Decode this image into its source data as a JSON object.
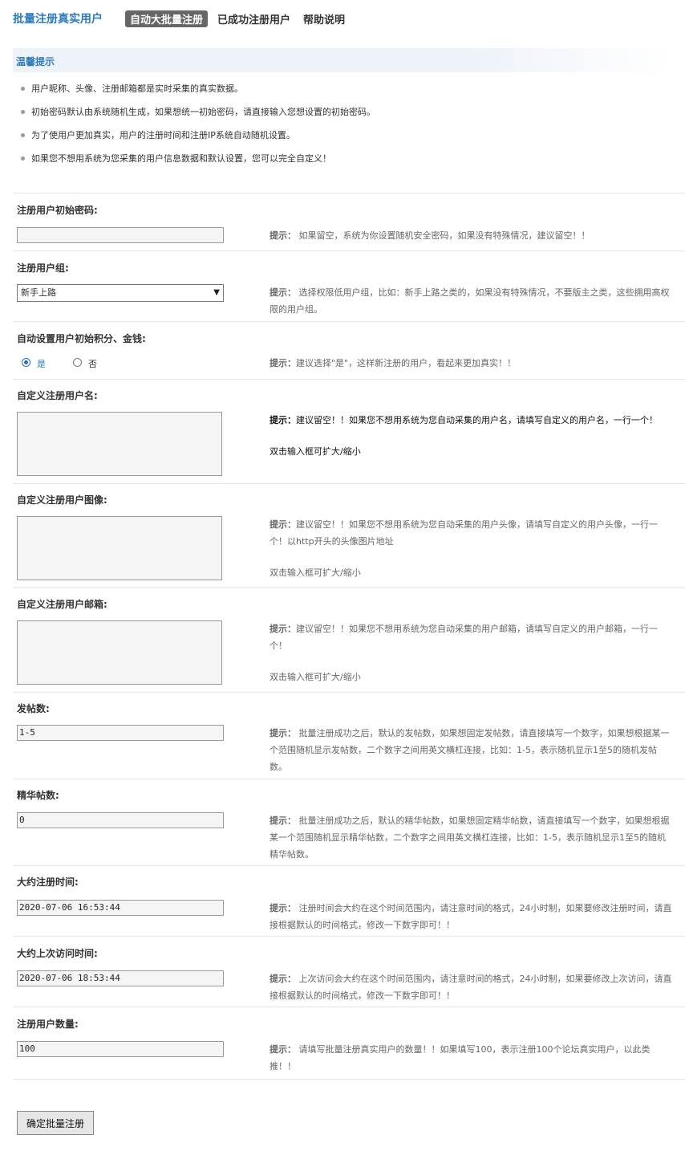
{
  "header": {
    "title": "批量注册真实用户",
    "tabs": [
      {
        "label": "自动大批量注册",
        "active": true
      },
      {
        "label": "已成功注册用户",
        "active": false
      },
      {
        "label": "帮助说明",
        "active": false
      }
    ]
  },
  "tips": {
    "title": "温馨提示",
    "items": [
      "用户昵称、头像、注册邮箱都是实时采集的真实数据。",
      "初始密码默认由系统随机生成，如果想统一初始密码，请直接输入您想设置的初始密码。",
      "为了使用户更加真实，用户的注册时间和注册IP系统自动随机设置。",
      "如果您不想用系统为您采集的用户信息数据和默认设置，您可以完全自定义！"
    ]
  },
  "hint_prefix": "提示：",
  "form": {
    "password": {
      "label": "注册用户初始密码:",
      "value": "",
      "hint": "如果留空，系统为你设置随机安全密码，如果没有特殊情况，建议留空！！"
    },
    "group": {
      "label": "注册用户组:",
      "selected": "新手上路",
      "hint": "选择权限低用户组，比如：新手上路之类的，如果没有特殊情况，不要版主之类，这些拥用高权限的用户组。"
    },
    "credits": {
      "label": "自动设置用户初始积分、金钱:",
      "option_yes": "是",
      "option_no": "否",
      "selected": "是",
      "hint": "建议选择\"是\"，这样新注册的用户，看起来更加真实！！"
    },
    "usernames": {
      "label": "自定义注册用户名:",
      "hint": "建议留空！！如果您不想用系统为您自动采集的用户名，请填写自定义的用户名，一行一个！",
      "sub": "双击输入框可扩大/缩小"
    },
    "avatars": {
      "label": "自定义注册用户图像:",
      "hint": "建议留空！！如果您不想用系统为您自动采集的用户头像，请填写自定义的用户头像，一行一个！以http开头的头像图片地址",
      "sub": "双击输入框可扩大/缩小"
    },
    "emails": {
      "label": "自定义注册用户邮箱:",
      "hint": "建议留空！！如果您不想用系统为您自动采集的用户邮箱，请填写自定义的用户邮箱，一行一个！",
      "sub": "双击输入框可扩大/缩小"
    },
    "posts": {
      "label": "发帖数:",
      "value": "1-5",
      "hint": "批量注册成功之后，默认的发帖数，如果想固定发帖数，请直接填写一个数字，如果想根据某一个范围随机显示发帖数，二个数字之间用英文横杠连接，比如：1-5，表示随机显示1至5的随机发帖数。"
    },
    "digests": {
      "label": "精华帖数:",
      "value": "0",
      "hint": "批量注册成功之后，默认的精华帖数，如果想固定精华帖数，请直接填写一个数字，如果想根据某一个范围随机显示精华帖数，二个数字之间用英文横杠连接，比如：1-5，表示随机显示1至5的随机精华帖数。"
    },
    "regtime": {
      "label": "大约注册时间:",
      "value": "2020-07-06 16:53:44",
      "hint": "注册时间会大约在这个时间范围内，请注意时间的格式，24小时制，如果要修改注册时间，请直接根据默认的时间格式，修改一下数字即可！！"
    },
    "lastvisit": {
      "label": "大约上次访问时间:",
      "value": "2020-07-06 18:53:44",
      "hint": "上次访问会大约在这个时间范围内，请注意时间的格式，24小时制，如果要修改上次访问，请直接根据默认的时间格式，修改一下数字即可！！"
    },
    "count": {
      "label": "注册用户数量:",
      "value": "100",
      "hint": "请填写批量注册真实用户的数量！！如果填写100，表示注册100个论坛真实用户，以此类推！！"
    }
  },
  "submit_label": "确定批量注册"
}
